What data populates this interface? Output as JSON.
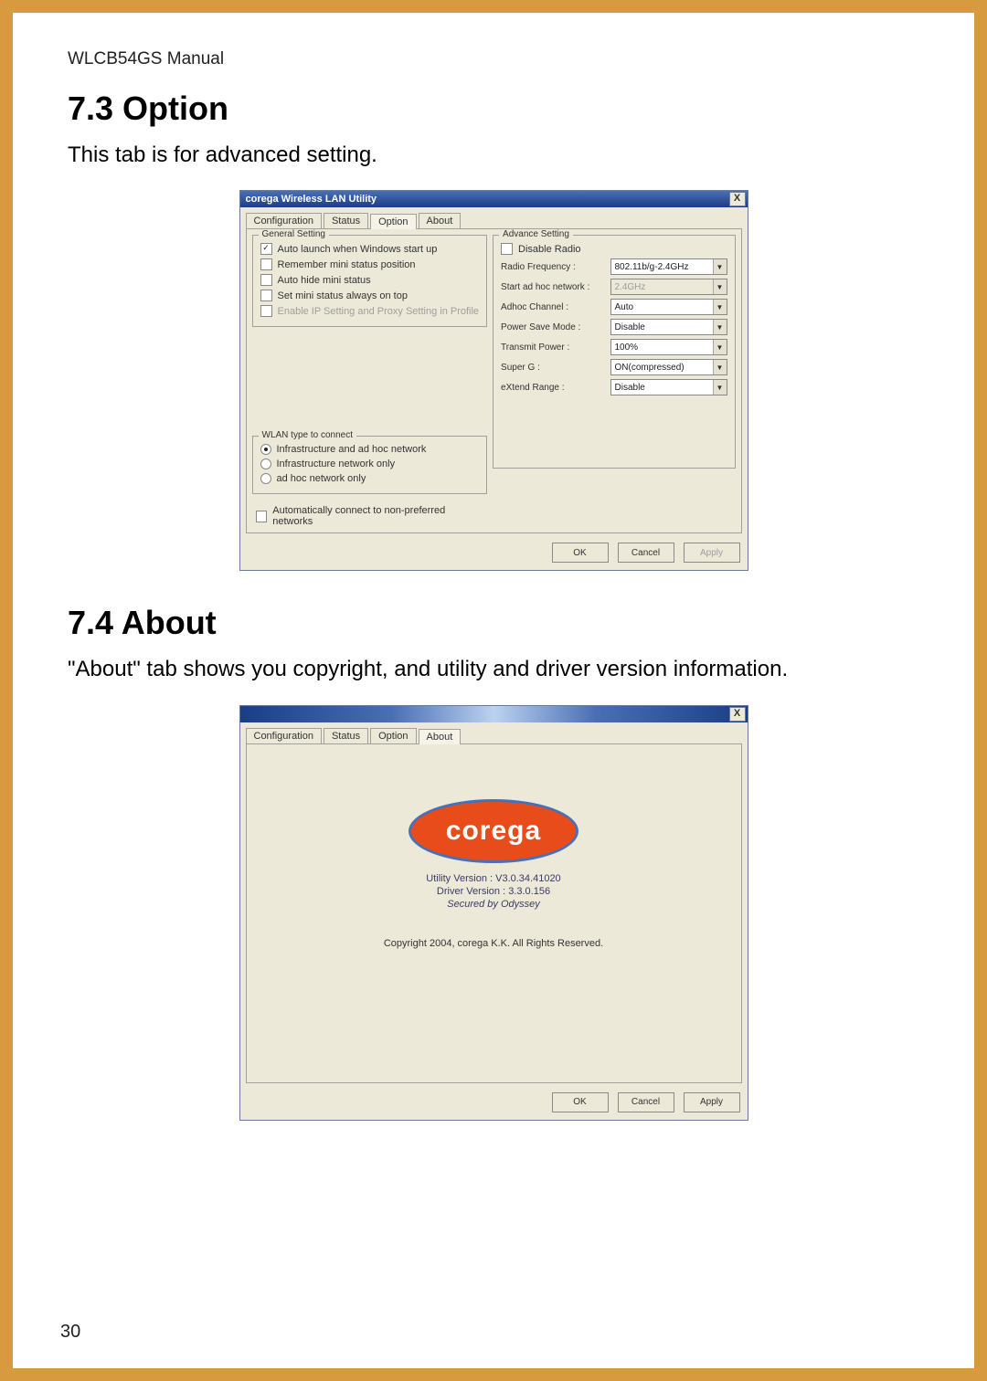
{
  "doc": {
    "header": "WLCB54GS Manual",
    "h_option": "7.3 Option",
    "p_option": "This tab is for advanced setting.",
    "h_about": "7.4 About",
    "p_about": "\"About\" tab shows you copyright, and utility and driver version information.",
    "page_num": "30"
  },
  "optionDlg": {
    "title": "corega Wireless LAN Utility",
    "close": "X",
    "tabs": {
      "configuration": "Configuration",
      "status": "Status",
      "option": "Option",
      "about": "About"
    },
    "general": {
      "legend": "General Setting",
      "auto_launch": "Auto launch when Windows start up",
      "remember": "Remember mini status position",
      "auto_hide": "Auto hide mini status",
      "set_top": "Set mini status always on top",
      "enable_ip": "Enable IP Setting and Proxy Setting in Profile"
    },
    "advance": {
      "legend": "Advance Setting",
      "disable_radio": "Disable Radio",
      "radio_freq_label": "Radio Frequency :",
      "radio_freq_value": "802.11b/g-2.4GHz",
      "start_adhoc_label": "Start ad hoc network :",
      "start_adhoc_value": "2.4GHz",
      "adhoc_ch_label": "Adhoc Channel :",
      "adhoc_ch_value": "Auto",
      "powersave_label": "Power Save Mode :",
      "powersave_value": "Disable",
      "txpower_label": "Transmit Power :",
      "txpower_value": "100%",
      "superg_label": "Super G :",
      "superg_value": "ON(compressed)",
      "extend_label": "eXtend Range :",
      "extend_value": "Disable"
    },
    "wlan": {
      "legend": "WLAN type to connect",
      "opt_both": "Infrastructure and ad hoc network",
      "opt_infra": "Infrastructure network only",
      "opt_adhoc": "ad hoc network only"
    },
    "auto_connect": "Automatically connect to non-preferred networks",
    "buttons": {
      "ok": "OK",
      "cancel": "Cancel",
      "apply": "Apply"
    }
  },
  "aboutDlg": {
    "close": "X",
    "tabs": {
      "configuration": "Configuration",
      "status": "Status",
      "option": "Option",
      "about": "About"
    },
    "logo_text": "corega",
    "utility_label": "Utility Version :",
    "utility_value": "V3.0.34.41020",
    "driver_label": "Driver Version :",
    "driver_value": "3.3.0.156",
    "secured": "Secured by Odyssey",
    "copyright": "Copyright 2004, corega K.K. All Rights Reserved.",
    "buttons": {
      "ok": "OK",
      "cancel": "Cancel",
      "apply": "Apply"
    }
  }
}
